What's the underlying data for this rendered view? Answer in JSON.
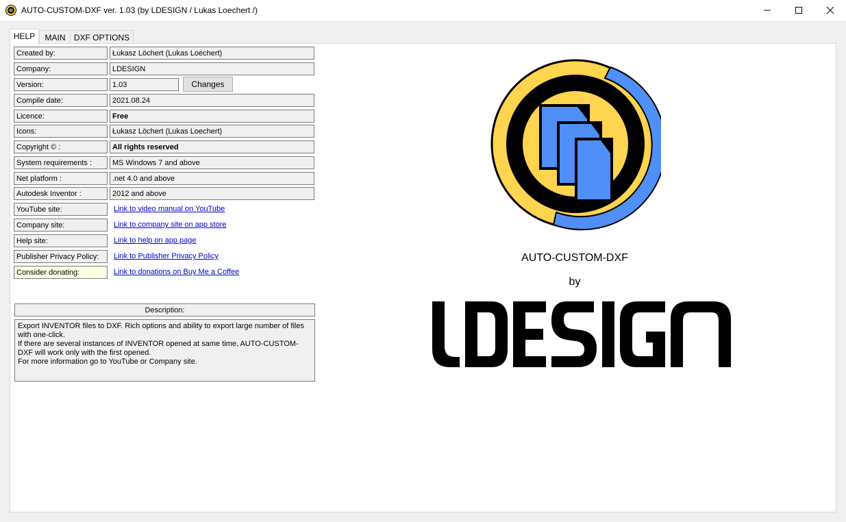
{
  "window": {
    "title": "AUTO-CUSTOM-DXF ver. 1.03 (by LDESIGN / Lukas Loechert /)"
  },
  "tabs": [
    {
      "label": "HELP"
    },
    {
      "label": "MAIN"
    },
    {
      "label": "DXF OPTIONS"
    }
  ],
  "info": {
    "created_by": {
      "label": "Created by:",
      "value": "Łukasz Löchert (Lukas Loechert)"
    },
    "company": {
      "label": "Company:",
      "value": "LDESIGN"
    },
    "version": {
      "label": "Version:",
      "value": "1.03",
      "button": "Changes"
    },
    "compile_date": {
      "label": "Compile date:",
      "value": "2021.08.24"
    },
    "licence": {
      "label": "Licence:",
      "value": "Free"
    },
    "icons": {
      "label": "Icons:",
      "value": "Łukasz Löchert (Lukas Loechert)"
    },
    "copyright": {
      "label": "Copyright © :",
      "value": "All rights reserved"
    },
    "system_req": {
      "label": "System requirements :",
      "value": "MS Windows 7 and above"
    },
    "net_platform": {
      "label": "Net platform :",
      "value": ".net 4.0 and above"
    },
    "inventor": {
      "label": "Autodesk Inventor :",
      "value": "2012 and above"
    }
  },
  "links": {
    "youtube": {
      "label": "YouTube site:",
      "text": "Link to video manual on YouTube"
    },
    "company_site": {
      "label": "Company site:",
      "text": "Link to company site on app store"
    },
    "help_site": {
      "label": "Help site:",
      "text": "Link to help on app page"
    },
    "privacy": {
      "label": "Publisher Privacy Policy:",
      "text": "Link to Publisher Privacy Policy"
    },
    "donate": {
      "label": "Consider donating:",
      "text": "Link to donations on Buy Me a Coffee"
    }
  },
  "description": {
    "header": "Description:",
    "lines": [
      "Export INVENTOR files to DXF. Rich options and ability to export large number of files with one-click.",
      "If there are several instances of INVENTOR opened at same time, AUTO-CUSTOM-DXF will work only with the first opened.",
      "For more information go to YouTube or Company site."
    ]
  },
  "branding": {
    "app_name": "AUTO-CUSTOM-DXF",
    "by": "by",
    "company_logo": "LDESIGN",
    "logo_colors": {
      "yellow": "#ffd44f",
      "blue": "#4f8ff7",
      "black": "#000000"
    }
  },
  "icons": {
    "app": "app-logo-icon",
    "minimize": "minimize-icon",
    "maximize": "maximize-icon",
    "close": "close-icon"
  }
}
